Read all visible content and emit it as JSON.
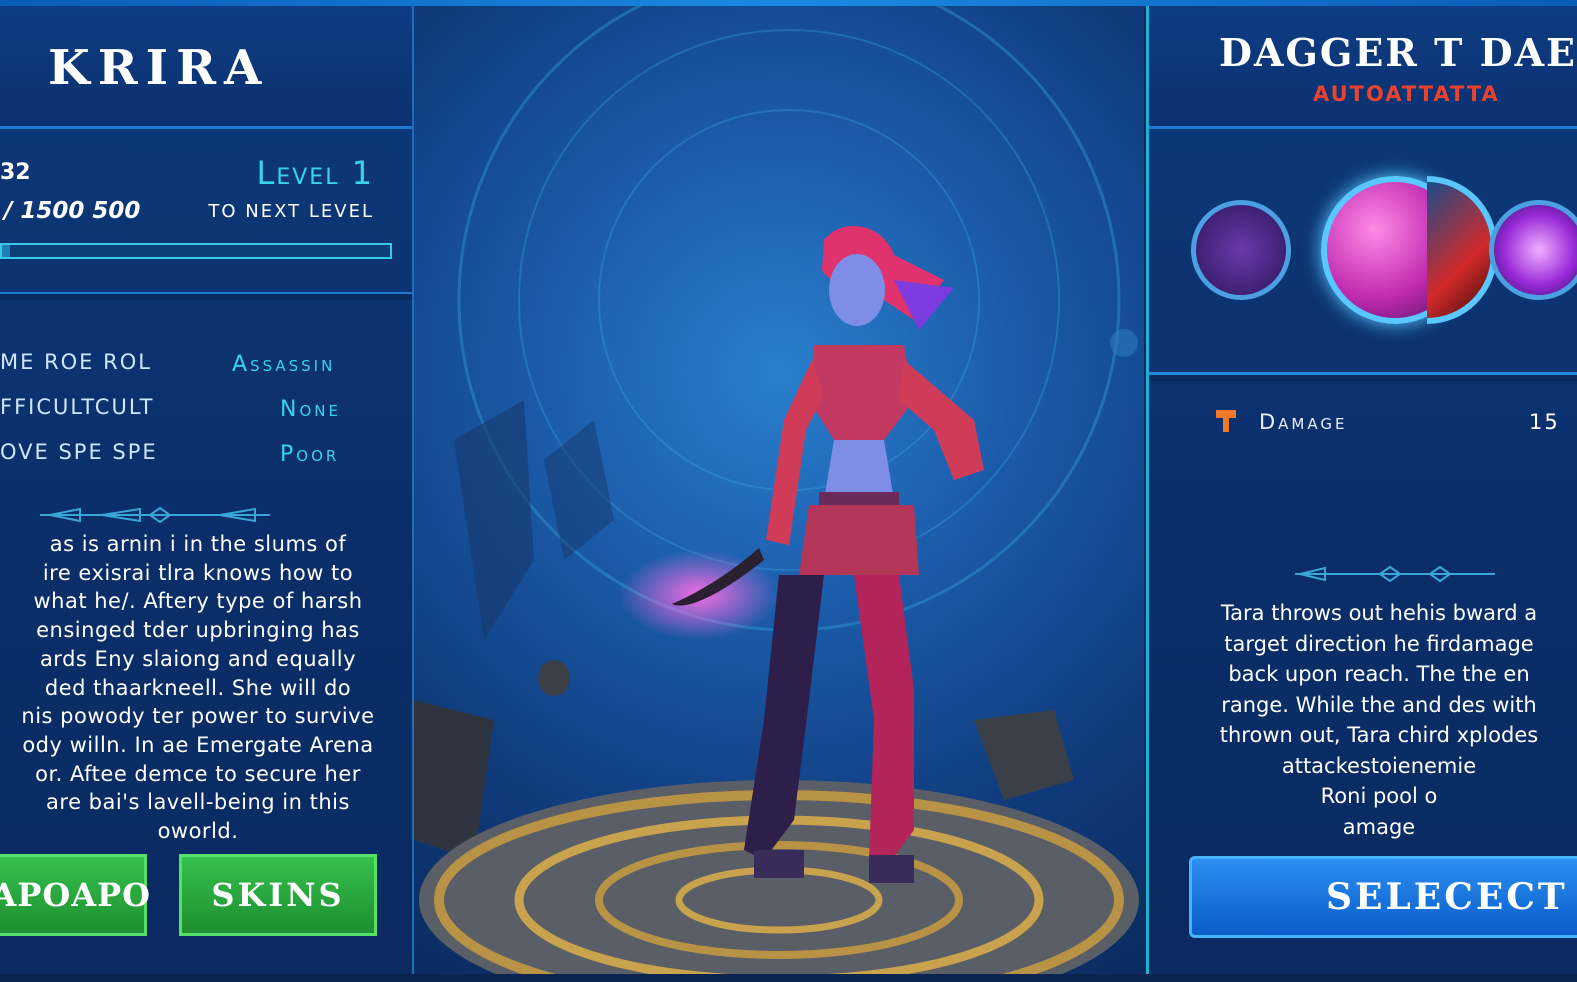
{
  "hero": {
    "name": "KRIRA",
    "level_label": "Level 1",
    "xp_current": "32",
    "xp_total": "/ 1500 500",
    "next_level_text": "TO NEXT LEVEL",
    "xp_progress": 0.02
  },
  "stats": [
    {
      "label": "ME ROE ROL",
      "value": "Assassin"
    },
    {
      "label": "FFICULTCULT",
      "value": "None"
    },
    {
      "label": "OVE SPE SPE",
      "value": "Poor"
    }
  ],
  "lore_text": "as is arnin i in the slums of\nire exisrai tlra knows how to\nwhat he/. Aftery type of harsh\nensinged tder upbringing has\nards Eny slaiong and equally\nded thaarkneell. She will do\nnis powody ter power to survive\nody willn. In ae Emergate Arena\nor. Aftee demce to secure her\nare bai's lavell-being in this\noworld.",
  "buttons": {
    "weapon": "EAPOAPO",
    "skins": "SKINS",
    "select": "SELECECT"
  },
  "ability": {
    "name": "DAGGER T DAE",
    "type": "AUTOATTATTA",
    "stat_label": "Damage",
    "stat_value": "15",
    "description": "Tara throws out hehis bward a\ntarget direction he firdamage\nback upon reach. The the en\nrange. While the and des with\nthrown out, Tara chird xplodes\nattackestoienemie\nRoni pool o\namage"
  },
  "icons": {
    "damage_icon": "damage-icon",
    "skills": [
      "silhouette-skill-icon",
      "pink-slash-skill-icon",
      "red-blade-skill-icon",
      "violet-burst-skill-icon"
    ]
  },
  "colors": {
    "accent_cyan": "#38d2f0",
    "autoattack_red": "#e8432f",
    "button_green": "#2fb445",
    "button_blue": "#1a78e4",
    "panel_blue": "#0c3470"
  }
}
